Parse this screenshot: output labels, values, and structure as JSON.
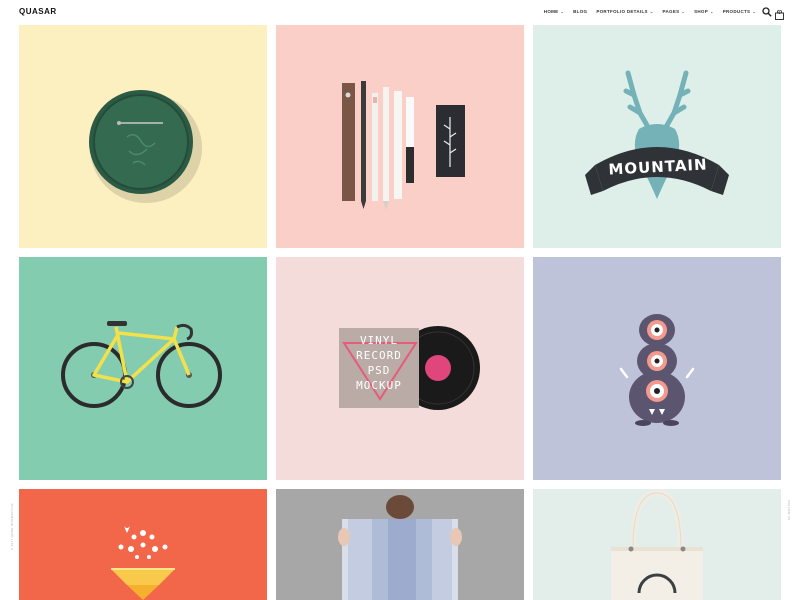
{
  "header": {
    "logo": "QUASAR",
    "nav": [
      {
        "label": "HOME",
        "dropdown": true
      },
      {
        "label": "BLOG",
        "dropdown": false
      },
      {
        "label": "PORTFOLIO DETAILS",
        "dropdown": true
      },
      {
        "label": "PAGES",
        "dropdown": true
      },
      {
        "label": "SHOP",
        "dropdown": true
      },
      {
        "label": "PRODUCTS",
        "dropdown": true
      }
    ],
    "cart_count": "0",
    "icons": {
      "search": "search-icon",
      "cart": "cart-icon",
      "dropdown": "chevron-down-icon"
    }
  },
  "side": {
    "left_text": "© 2017 QODE INTERACTIVE",
    "right_text": "FOLLOW US"
  },
  "portfolio": {
    "items": [
      {
        "subject": "green pin button",
        "bg": "#fcefc0"
      },
      {
        "subject": "stationery set",
        "bg": "#f9cfc8"
      },
      {
        "subject": "deer head badge",
        "bg": "#deeee9",
        "badge_text": "MOUNTAIN"
      },
      {
        "subject": "yellow bicycle",
        "bg": "#84ccb0"
      },
      {
        "subject": "vinyl record mockup",
        "bg": "#f3dcd9",
        "cover_text": [
          "VINYL",
          "RECORD",
          "PSD",
          "MOCKUP"
        ]
      },
      {
        "subject": "fuzzy monster",
        "bg": "#bfc3da"
      },
      {
        "subject": "diamond with drops",
        "bg": "#f2664a"
      },
      {
        "subject": "person holding poster",
        "bg": "#a7a7a7"
      },
      {
        "subject": "tote bag",
        "bg": "#e3eeeb"
      }
    ]
  }
}
